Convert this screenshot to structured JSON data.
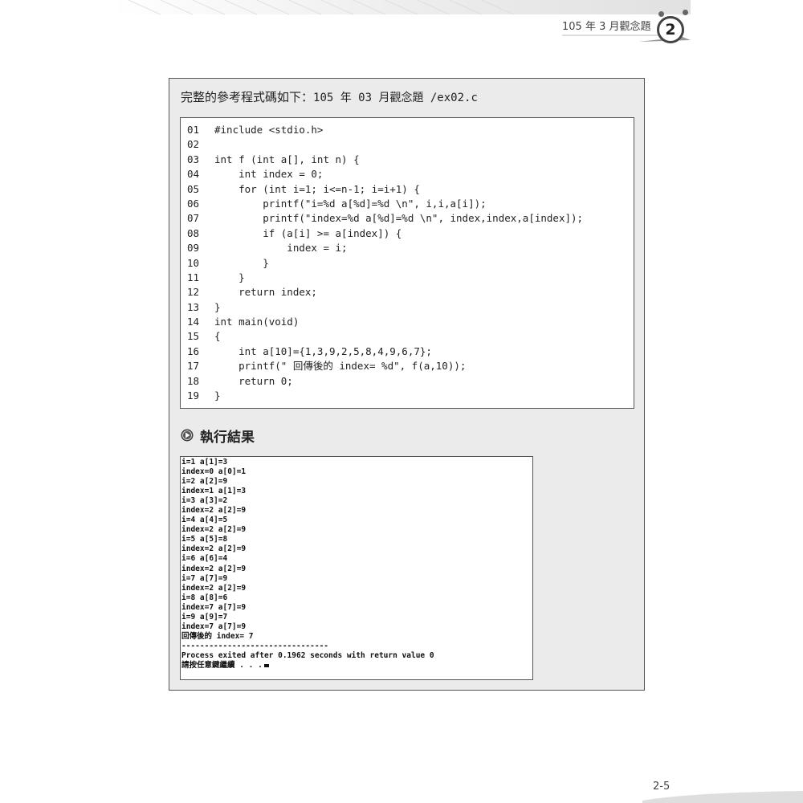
{
  "header": {
    "title": "105 年 3 月觀念題",
    "chapter_number": "2"
  },
  "panel": {
    "title_prefix": "完整的參考程式碼如下：",
    "title_path": "105 年 03 月觀念題 /ex02.c",
    "code_lines": [
      {
        "no": "01",
        "code": "#include <stdio.h>"
      },
      {
        "no": "02",
        "code": ""
      },
      {
        "no": "03",
        "code": "int f (int a[], int n) {"
      },
      {
        "no": "04",
        "code": "    int index = 0;"
      },
      {
        "no": "05",
        "code": "    for (int i=1; i<=n-1; i=i+1) {"
      },
      {
        "no": "06",
        "code": "        printf(\"i=%d a[%d]=%d \\n\", i,i,a[i]);"
      },
      {
        "no": "07",
        "code": "        printf(\"index=%d a[%d]=%d \\n\", index,index,a[index]);"
      },
      {
        "no": "08",
        "code": "        if (a[i] >= a[index]) {"
      },
      {
        "no": "09",
        "code": "            index = i;"
      },
      {
        "no": "10",
        "code": "        }"
      },
      {
        "no": "11",
        "code": "    }"
      },
      {
        "no": "12",
        "code": "    return index;"
      },
      {
        "no": "13",
        "code": "}"
      },
      {
        "no": "14",
        "code": "int main(void)"
      },
      {
        "no": "15",
        "code": "{"
      },
      {
        "no": "16",
        "code": "    int a[10]={1,3,9,2,5,8,4,9,6,7};"
      },
      {
        "no": "17",
        "code": "    printf(\" 回傳後的 index= %d\", f(a,10));"
      },
      {
        "no": "18",
        "code": "    return 0;"
      },
      {
        "no": "19",
        "code": "}"
      }
    ],
    "result_heading": "執行結果",
    "console_lines": [
      "i=1 a[1]=3",
      "index=0 a[0]=1",
      "i=2 a[2]=9",
      "index=1 a[1]=3",
      "i=3 a[3]=2",
      "index=2 a[2]=9",
      "i=4 a[4]=5",
      "index=2 a[2]=9",
      "i=5 a[5]=8",
      "index=2 a[2]=9",
      "i=6 a[6]=4",
      "index=2 a[2]=9",
      "i=7 a[7]=9",
      "index=2 a[2]=9",
      "i=8 a[8]=6",
      "index=7 a[7]=9",
      "i=9 a[9]=7",
      "index=7 a[7]=9",
      "回傳後的 index= 7",
      "--------------------------------",
      "Process exited after 0.1962 seconds with return value 0",
      "請按任意鍵繼續 . . ."
    ]
  },
  "footer": {
    "page_number": "2-5"
  },
  "colors": {
    "panel_background": "#ebebeb",
    "border": "#555555"
  }
}
